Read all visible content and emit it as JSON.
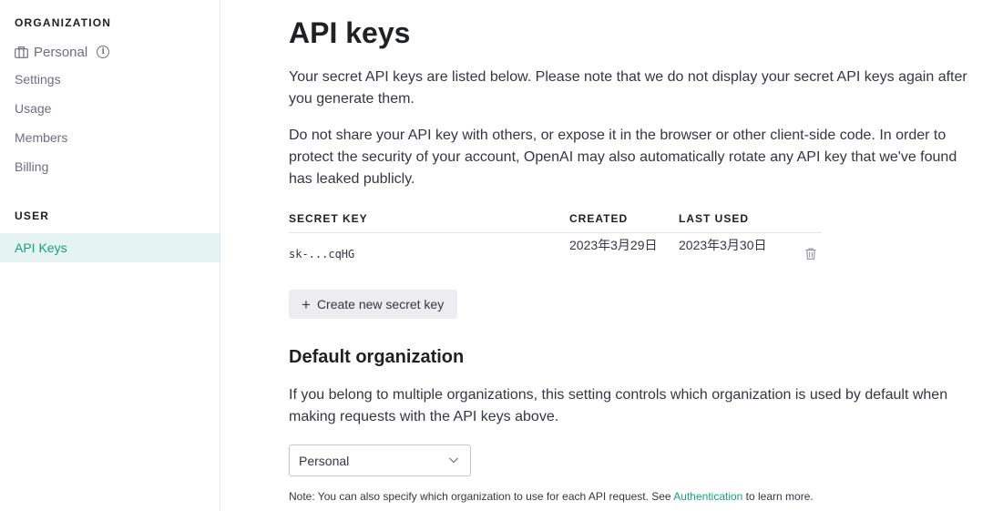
{
  "sidebar": {
    "organization_title": "ORGANIZATION",
    "org_name": "Personal",
    "items": [
      "Settings",
      "Usage",
      "Members",
      "Billing"
    ],
    "user_title": "USER",
    "active_item": "API Keys"
  },
  "main": {
    "title": "API keys",
    "para1": "Your secret API keys are listed below. Please note that we do not display your secret API keys again after you generate them.",
    "para2": "Do not share your API key with others, or expose it in the browser or other client-side code. In order to protect the security of your account, OpenAI may also automatically rotate any API key that we've found has leaked publicly.",
    "table": {
      "headers": {
        "key": "SECRET KEY",
        "created": "CREATED",
        "last_used": "LAST USED"
      },
      "rows": [
        {
          "key": "sk-...cqHG",
          "created": "2023年3月29日",
          "last_used": "2023年3月30日"
        }
      ]
    },
    "create_button": "Create new secret key",
    "default_org_title": "Default organization",
    "para3": "If you belong to multiple organizations, this setting controls which organization is used by default when making requests with the API keys above.",
    "select_value": "Personal",
    "note_prefix": "Note: You can also specify which organization to use for each API request. See ",
    "note_link": "Authentication",
    "note_suffix": " to learn more."
  },
  "colors": {
    "accent": "#10a37f",
    "active_bg": "#e6f3f3",
    "button_bg": "#ececf1"
  },
  "icons": {
    "org": "building-icon",
    "info": "info-icon",
    "delete": "trash-icon",
    "add": "plus-icon",
    "dropdown": "chevron-down-icon"
  }
}
